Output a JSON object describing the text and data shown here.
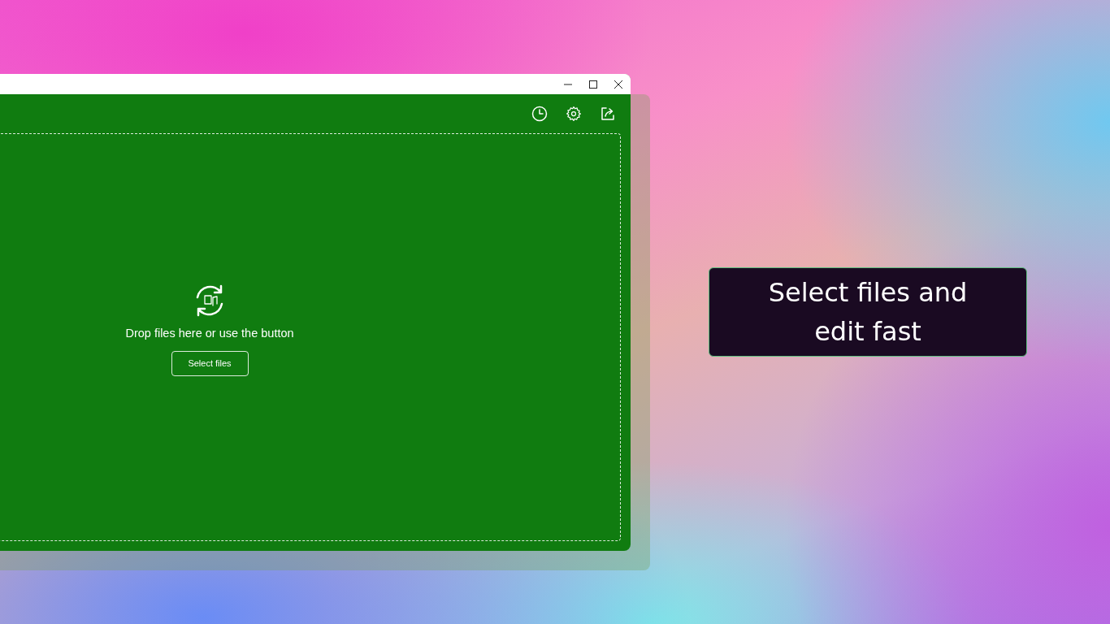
{
  "drop_zone": {
    "message": "Drop files here or use the button",
    "button": "Select files"
  },
  "caption": {
    "text": "Select files and edit fast"
  }
}
